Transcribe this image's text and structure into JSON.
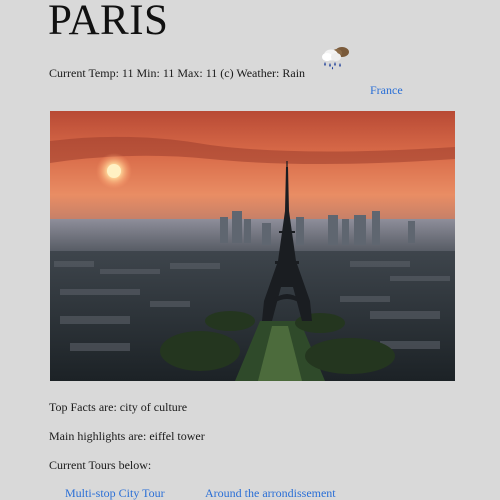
{
  "city": {
    "name": "PARIS"
  },
  "weather": {
    "summary": "Current Temp: 11 Min: 11 Max: 11 (c) Weather: Rain",
    "icon": "rain-cloud-icon"
  },
  "country": {
    "link_label": "France"
  },
  "hero_image": {
    "subject": "eiffel-tower-sunset-photo"
  },
  "facts": {
    "top_facts": "Top Facts are: city of culture",
    "highlights": "Main highlights are: eiffel tower",
    "tours_heading": "Current Tours below:"
  },
  "tours": [
    {
      "label": "Multi-stop City Tour"
    },
    {
      "label": "Around the arrondissement"
    }
  ],
  "colors": {
    "background": "#d9d9d9",
    "link": "#2a6fd6",
    "sky_top": "#c9553a",
    "sky_horizon": "#e7825a",
    "sun": "#fff1c4"
  }
}
